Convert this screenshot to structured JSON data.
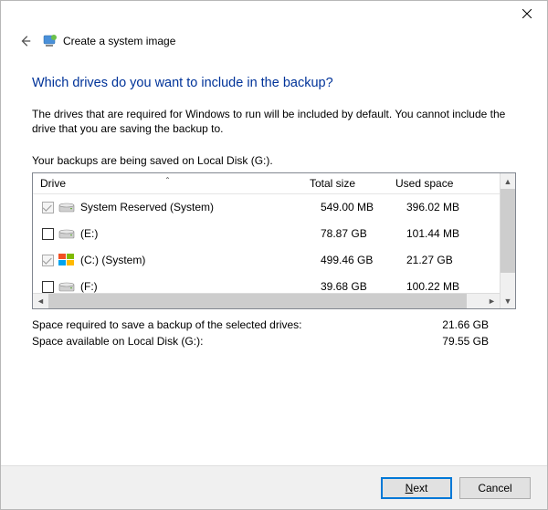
{
  "app": {
    "title": "Create a system image"
  },
  "page": {
    "heading": "Which drives do you want to include in the backup?",
    "description": "The drives that are required for Windows to run will be included by default. You cannot include the drive that you are saving the backup to.",
    "save_location_line": "Your backups are being saved on Local Disk (G:)."
  },
  "columns": {
    "drive": "Drive",
    "total": "Total size",
    "used": "Used space"
  },
  "drives": [
    {
      "name": "System Reserved (System)",
      "total": "549.00 MB",
      "used": "396.02 MB",
      "checked": true,
      "disabled": true,
      "icon": "hdd"
    },
    {
      "name": "(E:)",
      "total": "78.87 GB",
      "used": "101.44 MB",
      "checked": false,
      "disabled": false,
      "icon": "hdd"
    },
    {
      "name": "(C:) (System)",
      "total": "499.46 GB",
      "used": "21.27 GB",
      "checked": true,
      "disabled": true,
      "icon": "win"
    },
    {
      "name": "(F:)",
      "total": "39.68 GB",
      "used": "100.22 MB",
      "checked": false,
      "disabled": false,
      "icon": "hdd"
    }
  ],
  "summary": {
    "required_label": "Space required to save a backup of the selected drives:",
    "required_value": "21.66 GB",
    "available_label": "Space available on Local Disk (G:):",
    "available_value": "79.55 GB"
  },
  "buttons": {
    "next_mn": "N",
    "next_rest": "ext",
    "cancel": "Cancel"
  }
}
